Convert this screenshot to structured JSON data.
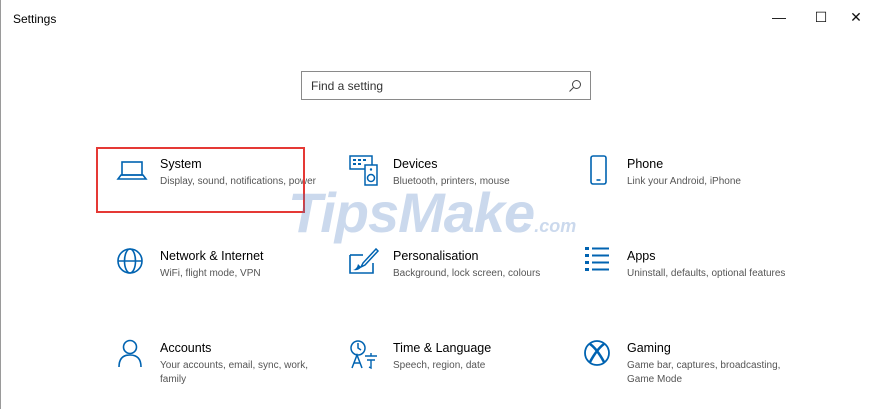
{
  "window": {
    "title": "Settings"
  },
  "controls": {
    "minimize": "—",
    "maximize": "☐",
    "close": "✕"
  },
  "search": {
    "placeholder": "Find a setting"
  },
  "watermark": {
    "main": "TipsMake",
    "suffix": ".com"
  },
  "tiles": [
    {
      "name": "System",
      "desc": "Display, sound, notifications, power",
      "icon": "laptop-icon"
    },
    {
      "name": "Devices",
      "desc": "Bluetooth, printers, mouse",
      "icon": "keyboard-speaker-icon"
    },
    {
      "name": "Phone",
      "desc": "Link your Android, iPhone",
      "icon": "phone-icon"
    },
    {
      "name": "Network & Internet",
      "desc": "WiFi, flight mode, VPN",
      "icon": "globe-icon"
    },
    {
      "name": "Personalisation",
      "desc": "Background, lock screen, colours",
      "icon": "brush-icon"
    },
    {
      "name": "Apps",
      "desc": "Uninstall, defaults, optional features",
      "icon": "apps-list-icon"
    },
    {
      "name": "Accounts",
      "desc": "Your accounts, email, sync, work, family",
      "icon": "person-icon"
    },
    {
      "name": "Time & Language",
      "desc": "Speech, region, date",
      "icon": "language-icon"
    },
    {
      "name": "Gaming",
      "desc": "Game bar, captures, broadcasting, Game Mode",
      "icon": "xbox-icon"
    }
  ],
  "colors": {
    "accent": "#0063b1",
    "highlight": "#e53935"
  }
}
